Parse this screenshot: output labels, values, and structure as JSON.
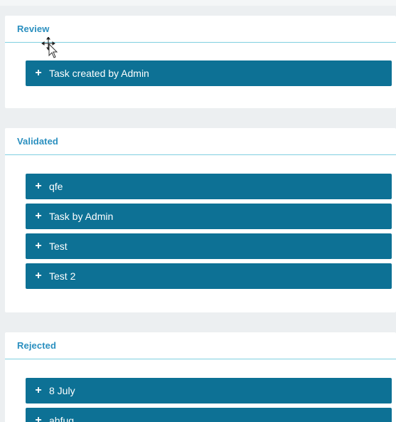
{
  "sections": [
    {
      "title": "Review",
      "tasks": [
        {
          "label": "Task created by Admin",
          "icon": "plus-icon"
        }
      ]
    },
    {
      "title": "Validated",
      "tasks": [
        {
          "label": "qfe",
          "icon": "plus-icon"
        },
        {
          "label": "Task by Admin",
          "icon": "plus-icon"
        },
        {
          "label": "Test",
          "icon": "plus-icon"
        },
        {
          "label": "Test 2",
          "icon": "plus-icon"
        }
      ]
    },
    {
      "title": "Rejected",
      "tasks": [
        {
          "label": "8 July",
          "icon": "plus-icon"
        },
        {
          "label": "ahfug",
          "icon": "plus-icon"
        }
      ]
    }
  ],
  "icons": {
    "plus": "+",
    "cursor": "move-cursor-icon"
  },
  "colors": {
    "accent": "#2a8fbf",
    "task_bar": "#0d7195",
    "divider": "#7fcfe0",
    "background": "#eceff1"
  }
}
